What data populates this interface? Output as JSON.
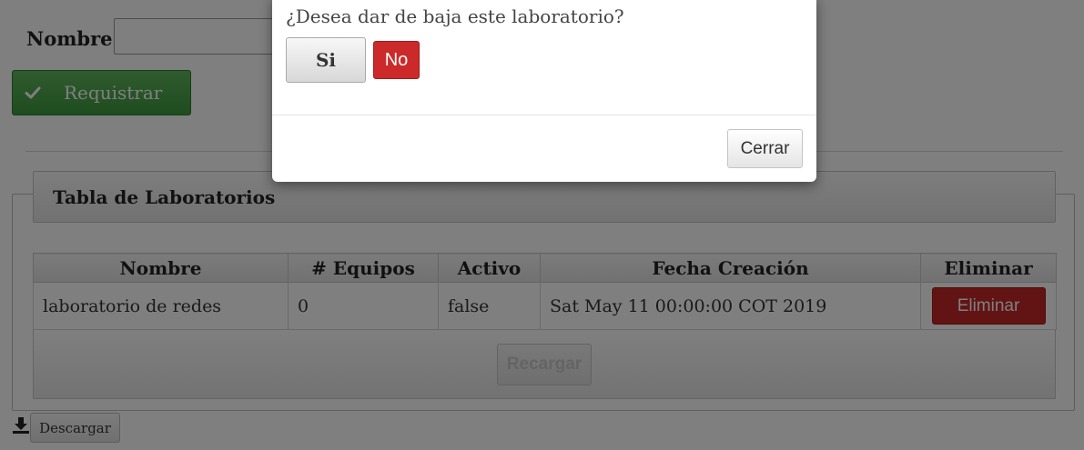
{
  "form": {
    "name_label": "Nombre:",
    "name_value": "",
    "register_label": "Requistrar"
  },
  "panel": {
    "title": "Tabla de Laboratorios"
  },
  "table": {
    "headers": [
      "Nombre",
      "# Equipos",
      "Activo",
      "Fecha Creación",
      "Eliminar"
    ],
    "rows": [
      {
        "nombre": "laboratorio de redes",
        "equipos": "0",
        "activo": "false",
        "fecha": "Sat May 11 00:00:00 COT 2019",
        "delete_label": "Eliminar"
      }
    ],
    "reload_label": "Recargar"
  },
  "download": {
    "label": "Descargar",
    "icon": "download-icon"
  },
  "modal": {
    "question": "¿Desea dar de baja este laboratorio?",
    "yes_label": "Si",
    "no_label": "No",
    "close_label": "Cerrar"
  },
  "colors": {
    "success": "#3e9a3e",
    "danger": "#c52828",
    "overlay": "#000000"
  }
}
